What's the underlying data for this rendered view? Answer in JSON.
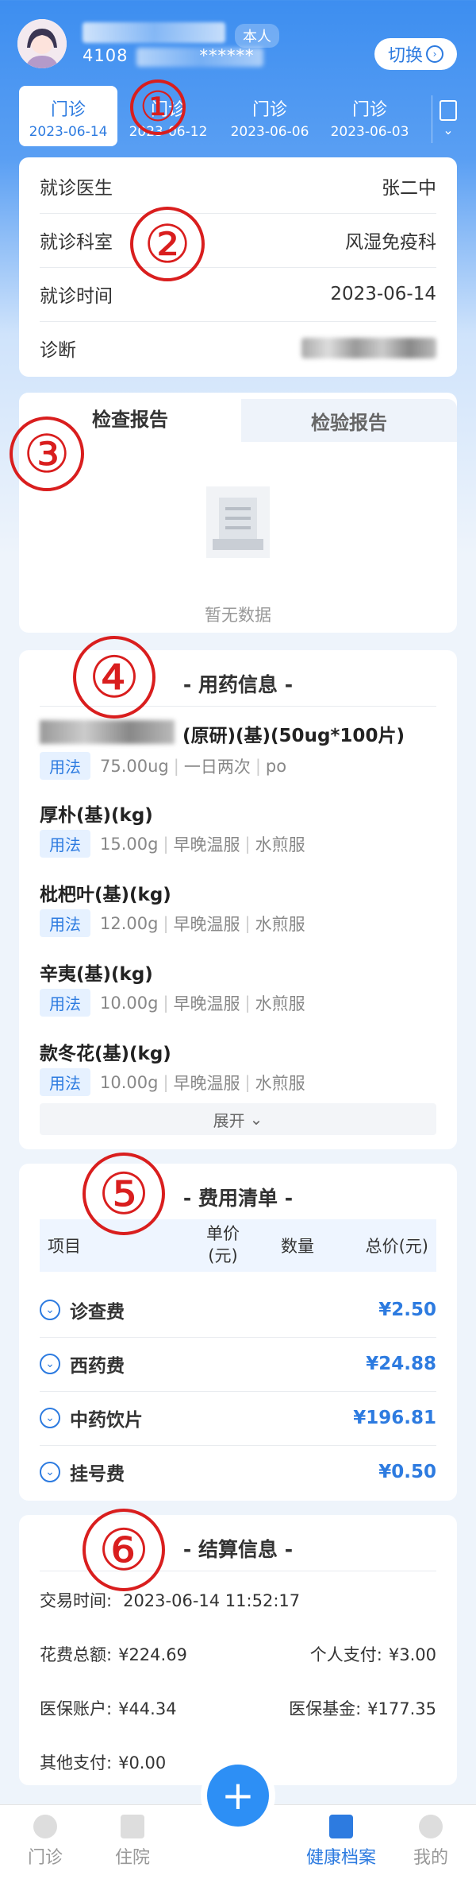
{
  "header": {
    "self_badge": "本人",
    "id_prefix": "4108",
    "id_mask": "******",
    "switch_label": "切换"
  },
  "tabs": [
    {
      "label": "门诊",
      "date": "2023-06-14",
      "active": true
    },
    {
      "label": "门诊",
      "date": "2023-06-12",
      "active": false
    },
    {
      "label": "门诊",
      "date": "2023-06-06",
      "active": false
    },
    {
      "label": "门诊",
      "date": "2023-06-03",
      "active": false
    }
  ],
  "visit": {
    "doctor_label": "就诊医生",
    "doctor": "张二中",
    "dept_label": "就诊科室",
    "dept": "风湿免疫科",
    "time_label": "就诊时间",
    "time": "2023-06-14",
    "diagnosis_label": "诊断"
  },
  "reports": {
    "tab_exam": "检查报告",
    "tab_lab": "检验报告",
    "empty": "暂无数据"
  },
  "medication": {
    "title": "- 用药信息 -",
    "usage_label": "用法",
    "items": [
      {
        "name": "(原研)(基)(50ug*100片)",
        "dose": "75.00ug",
        "freq": "一日两次",
        "route": "po"
      },
      {
        "name": "厚朴(基)(kg)",
        "dose": "15.00g",
        "freq": "早晚温服",
        "route": "水煎服"
      },
      {
        "name": "枇杷叶(基)(kg)",
        "dose": "12.00g",
        "freq": "早晚温服",
        "route": "水煎服"
      },
      {
        "name": "辛夷(基)(kg)",
        "dose": "10.00g",
        "freq": "早晚温服",
        "route": "水煎服"
      },
      {
        "name": "款冬花(基)(kg)",
        "dose": "10.00g",
        "freq": "早晚温服",
        "route": "水煎服"
      }
    ],
    "expand_label": "展开"
  },
  "fees": {
    "title": "- 费用清单 -",
    "headers": {
      "item": "项目",
      "unit_price": "单价",
      "unit_price_unit": "(元)",
      "qty": "数量",
      "total": "总价(元)"
    },
    "rows": [
      {
        "name": "诊查费",
        "amount": "¥2.50"
      },
      {
        "name": "西药费",
        "amount": "¥24.88"
      },
      {
        "name": "中药饮片",
        "amount": "¥196.81"
      },
      {
        "name": "挂号费",
        "amount": "¥0.50"
      }
    ]
  },
  "settlement": {
    "title": "- 结算信息 -",
    "trade_time_label": "交易时间:",
    "trade_time": "2023-06-14 11:52:17",
    "total_label": "花费总额:",
    "total": "¥224.69",
    "personal_label": "个人支付:",
    "personal": "¥3.00",
    "account_label": "医保账户:",
    "account": "¥44.34",
    "fund_label": "医保基金:",
    "fund": "¥177.35",
    "other_label": "其他支付:",
    "other": "¥0.00"
  },
  "annotations": [
    "①",
    "②",
    "③",
    "④",
    "⑤",
    "⑥"
  ],
  "nav": [
    {
      "label": "门诊",
      "active": false
    },
    {
      "label": "住院",
      "active": false
    },
    {
      "label": "健康档案",
      "active": true
    },
    {
      "label": "我的",
      "active": false
    }
  ],
  "plus_glyph": "+"
}
